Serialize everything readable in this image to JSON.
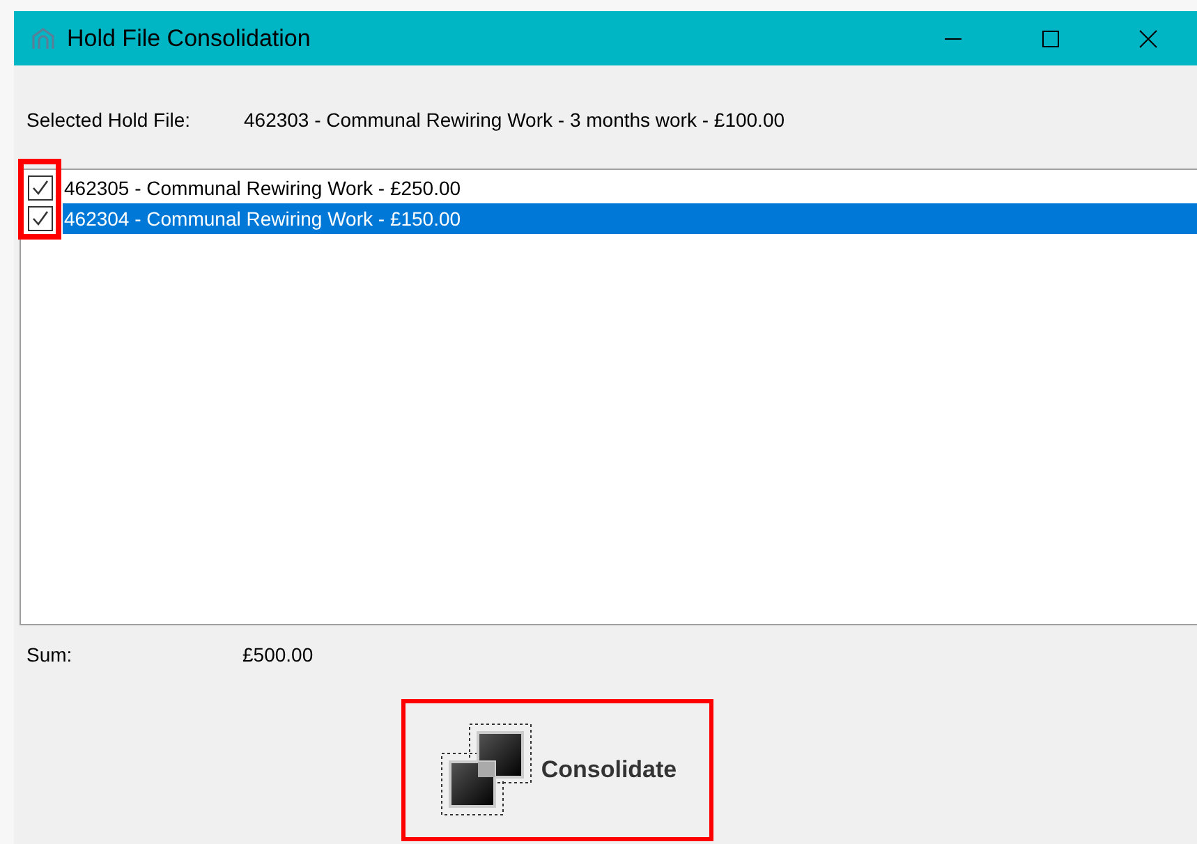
{
  "window": {
    "title": "Hold File Consolidation"
  },
  "selected_hold_file": {
    "label": "Selected Hold File:",
    "value": "462303 - Communal Rewiring Work - 3 months work - £100.00"
  },
  "list": {
    "checkboxes_highlighted": true,
    "items": [
      {
        "text": "462305 - Communal Rewiring Work - £250.00",
        "checked": true,
        "selected": false
      },
      {
        "text": "462304 - Communal Rewiring Work - £150.00",
        "checked": true,
        "selected": true
      }
    ]
  },
  "sum": {
    "label": "Sum:",
    "value": "£500.00"
  },
  "consolidate_button": {
    "label": "Consolidate",
    "highlighted": true
  }
}
